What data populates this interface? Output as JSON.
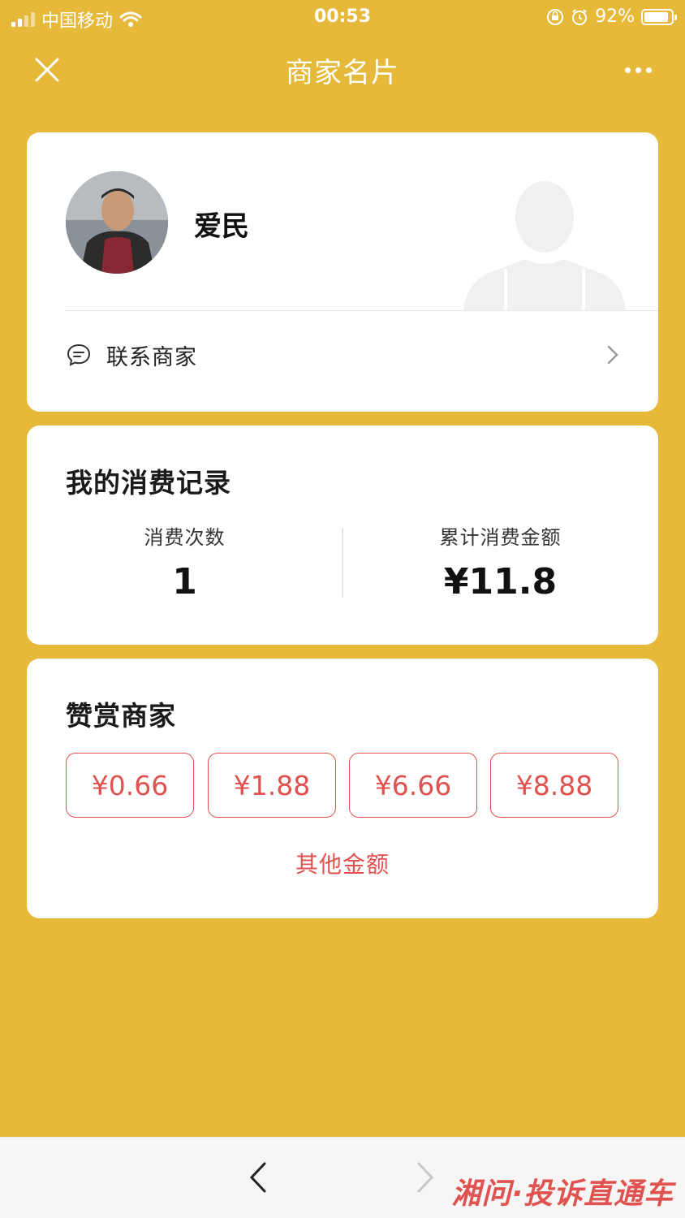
{
  "status_bar": {
    "carrier": "中国移动",
    "time": "00:53",
    "battery": "92%"
  },
  "nav": {
    "title": "商家名片"
  },
  "profile": {
    "name": "爱民",
    "contact_label": "联系商家"
  },
  "records": {
    "title": "我的消费记录",
    "count_label": "消费次数",
    "count_value": "1",
    "total_label": "累计消费金额",
    "total_value": "¥11.8"
  },
  "tip": {
    "title": "赞赏商家",
    "amounts": [
      "¥0.66",
      "¥1.88",
      "¥6.66",
      "¥8.88"
    ],
    "other_label": "其他金额"
  },
  "bottom": {
    "watermark": "湘问·投诉直通车"
  },
  "colors": {
    "background": "#E6B93A",
    "accent_red": "#E0524F",
    "card": "#FFFFFF"
  }
}
